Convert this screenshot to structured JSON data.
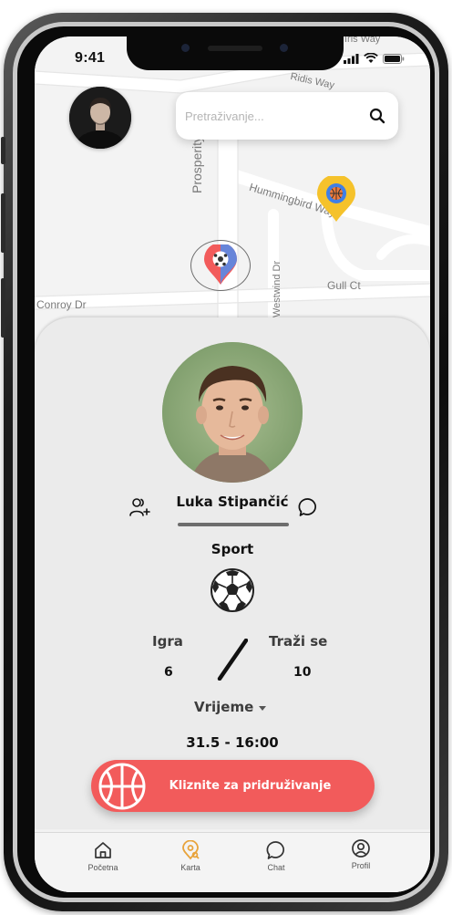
{
  "status": {
    "time": "9:41"
  },
  "search": {
    "placeholder": "Pretraživanje..."
  },
  "map": {
    "roads": [
      "Prosperity Farms",
      "Hummingbird Way",
      "Westwind Dr",
      "Gull Ct",
      "Conroy Dr",
      "Ridis Way",
      "Iris Way"
    ]
  },
  "profile": {
    "name": "Luka Stipančić",
    "sport_label": "Sport",
    "sport_icon": "soccer-ball-icon"
  },
  "stats": {
    "playing_label": "Igra",
    "playing_value": "6",
    "looking_label": "Traži se",
    "looking_value": "10"
  },
  "time": {
    "label": "Vrijeme",
    "value": "31.5 - 16:00"
  },
  "join": {
    "label": "Kliznite za pridruživanje"
  },
  "nav": [
    {
      "label": "Početna",
      "icon": "home-icon"
    },
    {
      "label": "Karta",
      "icon": "map-pin-icon"
    },
    {
      "label": "Chat",
      "icon": "chat-icon"
    },
    {
      "label": "Profil",
      "icon": "profile-icon"
    }
  ],
  "colors": {
    "accent": "#f25b5b",
    "active_nav": "#e8a33b",
    "pin_red": "#f25b5b",
    "pin_blue": "#4f8df0",
    "pin_yellow": "#f5c22b"
  }
}
